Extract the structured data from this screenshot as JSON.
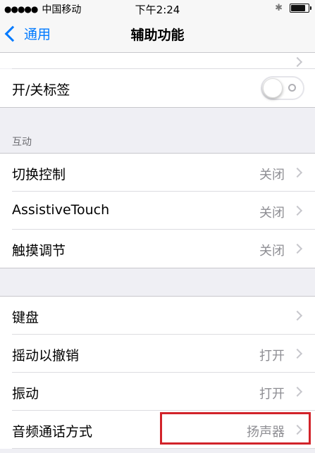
{
  "status_bar": {
    "signal_dots": "●●●●●",
    "carrier": "中国移动",
    "time": "下午2:24",
    "bluetooth_icon": "bluetooth-icon",
    "battery_level": 0.9
  },
  "nav": {
    "back_label": "通用",
    "title": "辅助功能"
  },
  "partial_row": {
    "label": "",
    "value": ""
  },
  "labels_row": {
    "label": "开/关标签",
    "toggle_on": false
  },
  "section_interaction": {
    "header": "互动",
    "rows": [
      {
        "label": "切换控制",
        "value": "关闭"
      },
      {
        "label": "AssistiveTouch",
        "value": "关闭"
      },
      {
        "label": "触摸调节",
        "value": "关闭"
      }
    ]
  },
  "section_more": {
    "rows": [
      {
        "label": "键盘",
        "value": ""
      },
      {
        "label": "摇动以撤销",
        "value": "打开"
      },
      {
        "label": "振动",
        "value": "打开"
      },
      {
        "label": "音频通话方式",
        "value": "扬声器"
      }
    ]
  },
  "colors": {
    "accent": "#007aff",
    "highlight": "#d2232a",
    "background": "#efeff4"
  }
}
